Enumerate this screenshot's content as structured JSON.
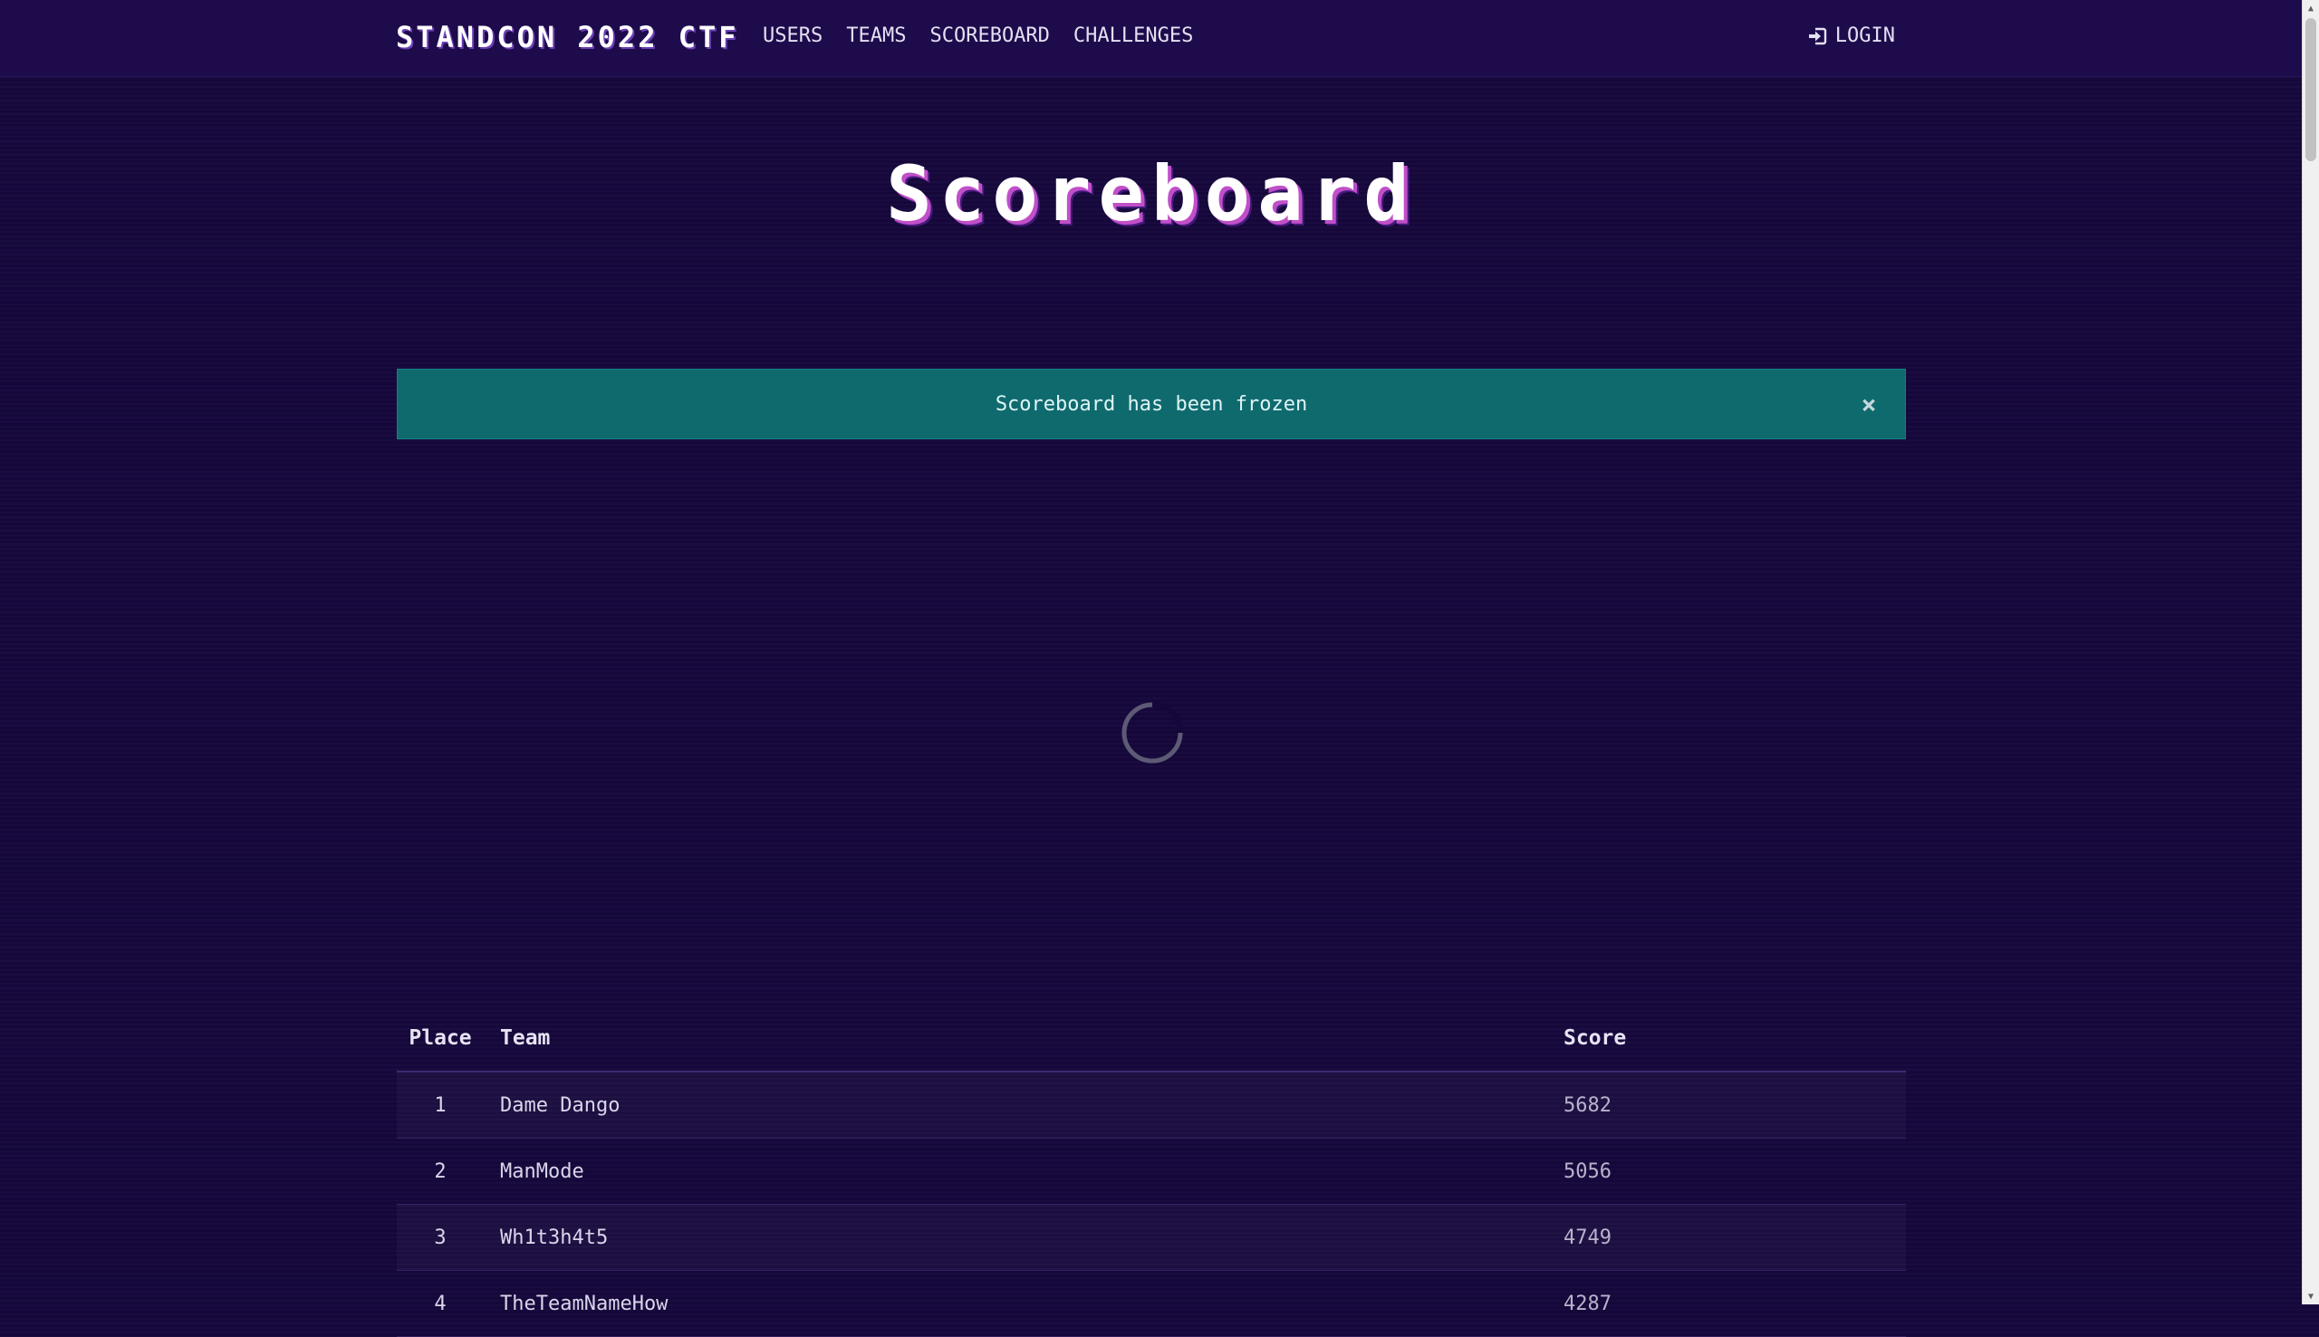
{
  "navbar": {
    "brand": "STANDCON 2022 CTF",
    "links": [
      "USERS",
      "TEAMS",
      "SCOREBOARD",
      "CHALLENGES"
    ],
    "login_label": "LOGIN",
    "login_icon": "sign-in-icon"
  },
  "page_title": "Scoreboard",
  "alert": {
    "message": "Scoreboard has been frozen",
    "close_icon": "close-icon"
  },
  "spinner": {
    "icon": "loading-spinner-icon"
  },
  "scoreboard": {
    "headers": {
      "place": "Place",
      "team": "Team",
      "score": "Score"
    },
    "rows": [
      {
        "place": "1",
        "team": "Dame Dango",
        "score": "5682"
      },
      {
        "place": "2",
        "team": "ManMode",
        "score": "5056"
      },
      {
        "place": "3",
        "team": "Wh1t3h4t5",
        "score": "4749"
      },
      {
        "place": "4",
        "team": "TheTeamNameHow",
        "score": "4287"
      }
    ]
  },
  "colors": {
    "background": "#15073a",
    "navbar": "#1e0b4b",
    "alert": "#0f6a6e",
    "title_shadow": "#c04fc8"
  }
}
